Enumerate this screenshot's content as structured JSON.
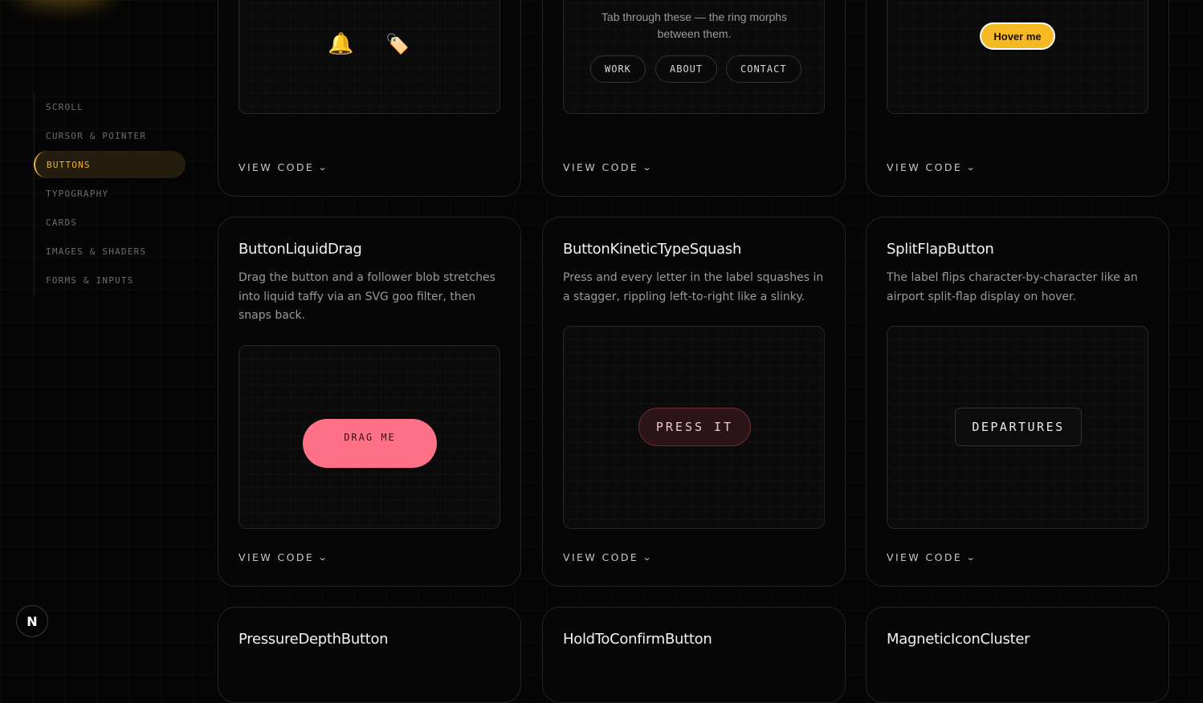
{
  "sidebar": {
    "items": [
      {
        "label": "SCROLL"
      },
      {
        "label": "CURSOR & POINTER"
      },
      {
        "label": "BUTTONS"
      },
      {
        "label": "TYPOGRAPHY"
      },
      {
        "label": "CARDS"
      },
      {
        "label": "IMAGES & SHADERS"
      },
      {
        "label": "FORMS & INPUTS"
      }
    ],
    "active": "BUTTONS"
  },
  "badge": {
    "label": "N"
  },
  "view_code_label": "VIEW CODE",
  "top_row": {
    "card1": {
      "icons": [
        "bell-icon",
        "tag-icon"
      ],
      "bell_glyph": "🔔",
      "tag_glyph": "🏷️"
    },
    "card2": {
      "desc": "Tab through these — the ring morphs between them.",
      "pills": [
        "WORK",
        "ABOUT",
        "CONTACT"
      ]
    },
    "card3": {
      "button_label": "Hover me"
    }
  },
  "middle_row": [
    {
      "title": "ButtonLiquidDrag",
      "desc": "Drag the button and a follower blob stretches into liquid taffy via an SVG goo filter, then snaps back.",
      "button_label": "DRAG ME"
    },
    {
      "title": "ButtonKineticTypeSquash",
      "desc": "Press and every letter in the label squashes in a stagger, rippling left-to-right like a slinky.",
      "button_label": "PRESS IT"
    },
    {
      "title": "SplitFlapButton",
      "desc": "The label flips character-by-character like an airport split-flap display on hover.",
      "button_label": "DEPARTURES"
    }
  ],
  "bottom_row": [
    {
      "title": "PressureDepthButton"
    },
    {
      "title": "HoldToConfirmButton"
    },
    {
      "title": "MagneticIconCluster"
    }
  ],
  "colors": {
    "accent": "#f0b429",
    "drag": "#ff7186",
    "press": "#2a1418"
  }
}
